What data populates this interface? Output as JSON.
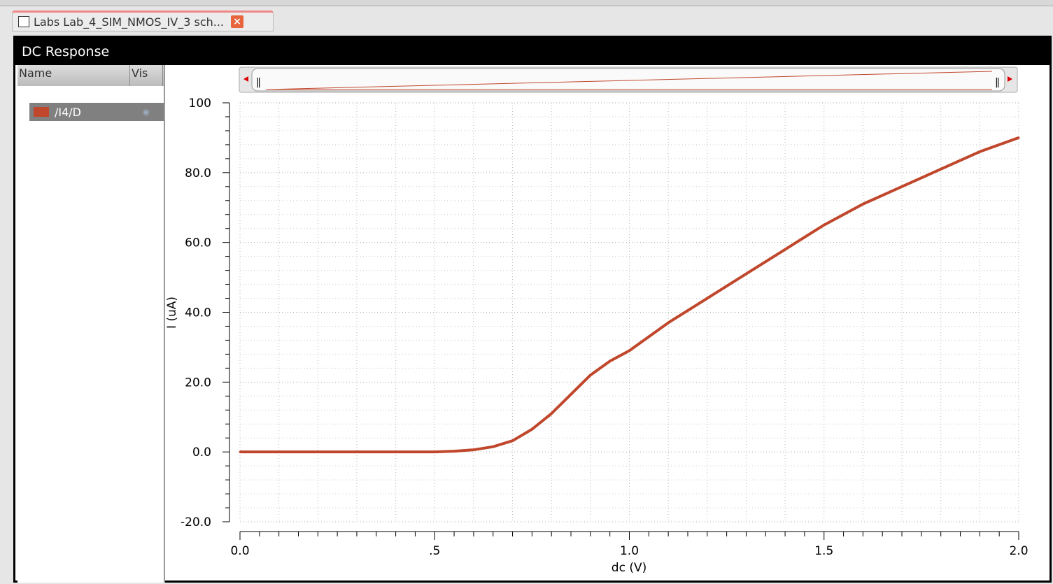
{
  "tab": {
    "title": "Labs Lab_4_SIM_NMOS_IV_3 sch...",
    "close_icon": "close-icon"
  },
  "window": {
    "title": "DC Response"
  },
  "legend": {
    "col_name": "Name",
    "col_vis": "Vis",
    "items": [
      {
        "name": "/I4/D",
        "color": "#c0472c",
        "visible": true
      }
    ]
  },
  "chart_data": {
    "type": "line",
    "title": "",
    "xlabel": "dc (V)",
    "ylabel": "I (uA)",
    "xlim": [
      0,
      2.0
    ],
    "ylim": [
      -20,
      100
    ],
    "xticks": [
      "0.0",
      ".5",
      "1.0",
      "1.5",
      "2.0"
    ],
    "yticks": [
      "100",
      "80.0",
      "60.0",
      "40.0",
      "20.0",
      "0.0",
      "-20.0"
    ],
    "grid": true,
    "series": [
      {
        "name": "/I4/D",
        "color": "#c0472c",
        "x": [
          0,
          0.1,
          0.2,
          0.3,
          0.4,
          0.5,
          0.55,
          0.6,
          0.65,
          0.7,
          0.75,
          0.8,
          0.85,
          0.9,
          0.95,
          1.0,
          1.1,
          1.2,
          1.3,
          1.4,
          1.5,
          1.6,
          1.7,
          1.8,
          1.9,
          2.0
        ],
        "y": [
          0,
          0,
          0,
          0,
          0,
          0,
          0.2,
          0.6,
          1.5,
          3.2,
          6.5,
          11,
          16.5,
          22,
          26,
          29,
          37,
          44,
          51,
          58,
          65,
          71,
          76,
          81,
          86,
          90
        ]
      }
    ]
  }
}
